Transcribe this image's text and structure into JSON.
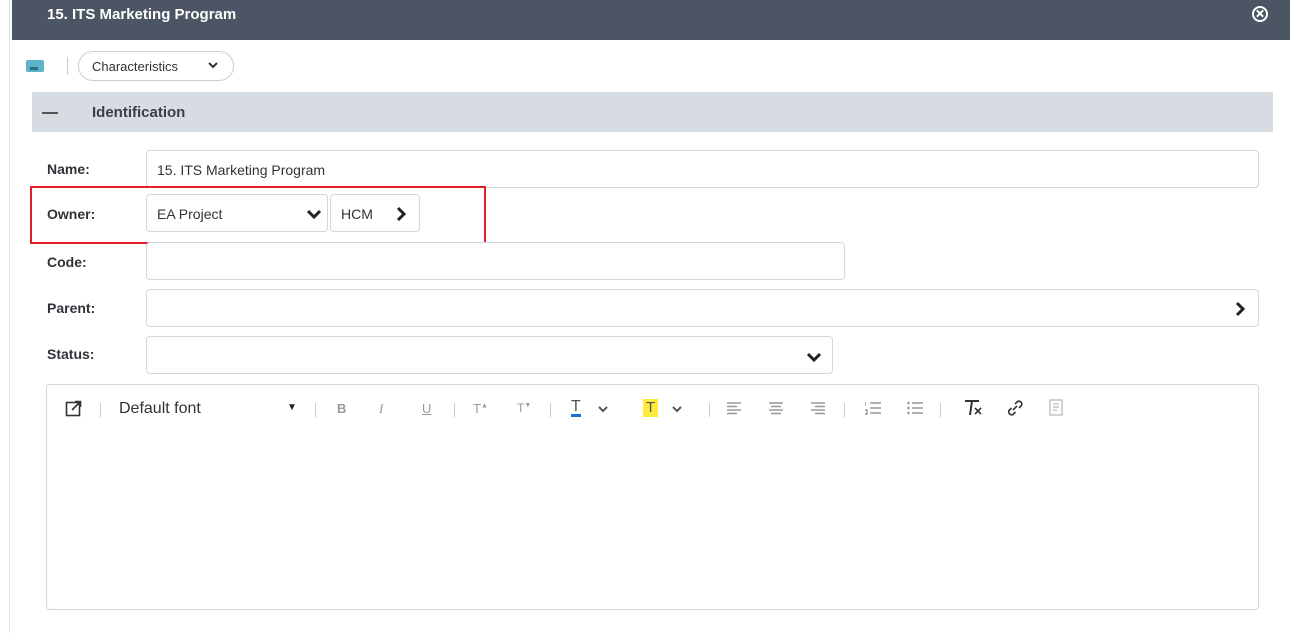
{
  "window": {
    "title": "15. ITS Marketing Program",
    "close_icon": "close-circle-icon"
  },
  "toolbar": {
    "view_icon": "view-card-icon",
    "characteristics_label": "Characteristics"
  },
  "section": {
    "title": "Identification",
    "collapse_icon": "minus-icon"
  },
  "form": {
    "name_label": "Name:",
    "name_value": "15.  ITS Marketing Program",
    "owner_label": "Owner:",
    "owner_value": "EA Project",
    "owner_sub_value": "HCM",
    "code_label": "Code:",
    "code_value": "",
    "parent_label": "Parent:",
    "parent_value": "",
    "status_label": "Status:",
    "status_value": ""
  },
  "editor": {
    "font_label": "Default font",
    "tools": {
      "bold": "B",
      "italic": "I",
      "underline": "U",
      "superscript": "T",
      "subscript": "T",
      "text_color": "T",
      "highlight": "T"
    }
  },
  "colors": {
    "title_bar": "#4b5563",
    "section_bg": "#d7dbe2",
    "highlight_border": "#e01f26",
    "highlight_yellow": "#ffeb3b"
  }
}
